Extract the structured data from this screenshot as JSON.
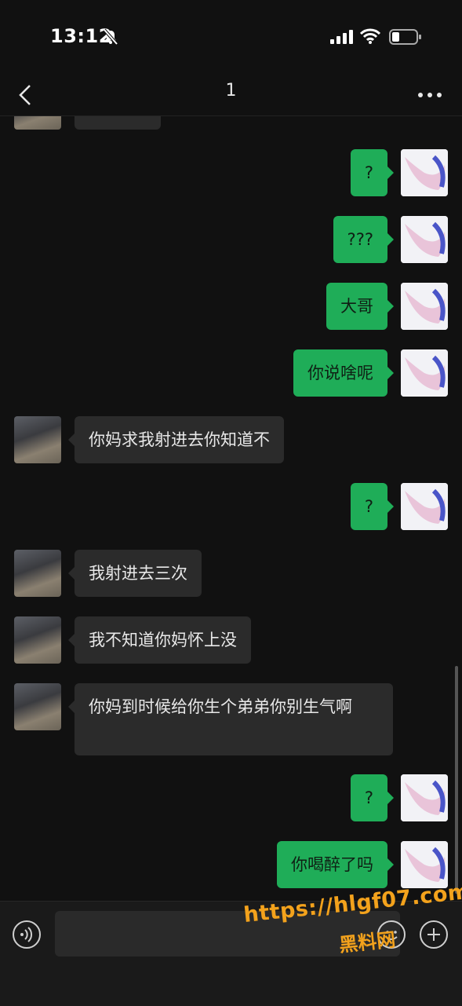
{
  "status": {
    "time": "13:12"
  },
  "header": {
    "title": "1"
  },
  "messages": [
    {
      "side": "right",
      "text": "?"
    },
    {
      "side": "right",
      "text": "???"
    },
    {
      "side": "right",
      "text": "大哥"
    },
    {
      "side": "right",
      "text": "你说啥呢"
    },
    {
      "side": "left",
      "text": "你妈求我射进去你知道不"
    },
    {
      "side": "right",
      "text": "?"
    },
    {
      "side": "left",
      "text": "我射进去三次"
    },
    {
      "side": "left",
      "text": "我不知道你妈怀上没"
    },
    {
      "side": "left",
      "text": "你妈到时候给你生个弟弟你别生气啊"
    },
    {
      "side": "right",
      "text": "?"
    },
    {
      "side": "right",
      "text": "你喝醉了吗"
    }
  ],
  "watermark": {
    "url": "https://hlgf07.com",
    "name": "黑料网"
  },
  "icons": {
    "back": "chevron-left-icon",
    "more": "more-dots-icon",
    "voice": "voice-icon",
    "emoji": "emoji-icon",
    "add": "plus-icon",
    "mute": "bell-slash-icon",
    "signal": "signal-icon",
    "wifi": "wifi-icon",
    "battery": "battery-icon"
  },
  "colors": {
    "background": "#111111",
    "outgoing_bubble": "#1fad58",
    "incoming_bubble": "#2b2b2b",
    "watermark": "#f3a21c"
  }
}
